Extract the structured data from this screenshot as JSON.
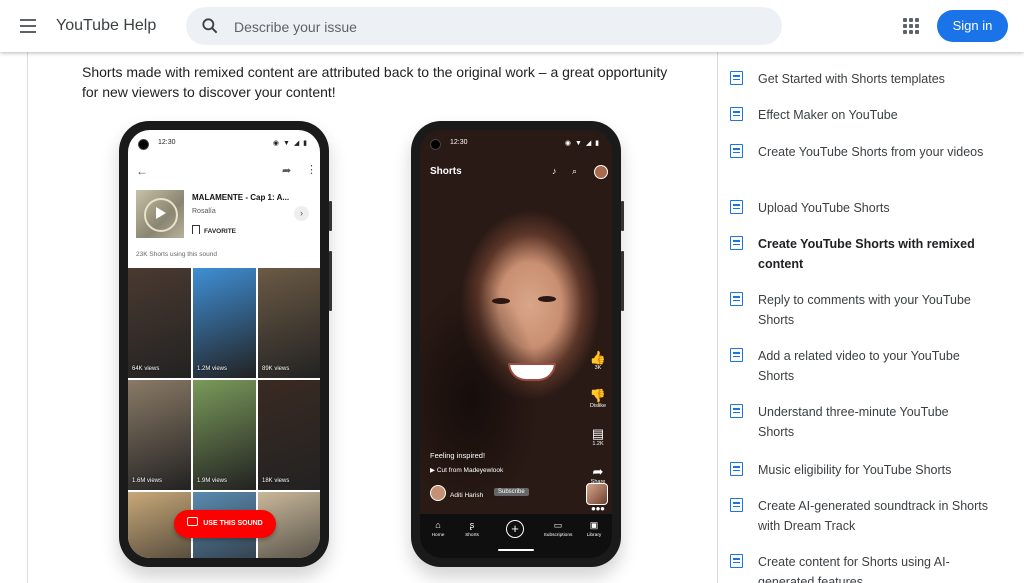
{
  "header": {
    "logo": "YouTube Help",
    "search_placeholder": "Describe your issue",
    "signin_label": "Sign in"
  },
  "main": {
    "intro": "Shorts made with remixed content are attributed back to the original work – a great opportunity for new viewers to discover your content!",
    "phone1": {
      "time": "12:30",
      "song_title": "MALAMENTE - Cap 1: A...",
      "artist": "Rosalía",
      "favorite_label": "FAVORITE",
      "shorts_count": "23K Shorts using this sound",
      "tiles": [
        {
          "views": "64K views",
          "color": "#4a3a30"
        },
        {
          "views": "1.2M views",
          "color": "#3f8fd6"
        },
        {
          "views": "89K views",
          "color": "#6b5a45"
        },
        {
          "views": "1.6M views",
          "color": "#8a7a66"
        },
        {
          "views": "1.9M views",
          "color": "#7a9a5a"
        },
        {
          "views": "18K views",
          "color": "#3a2a22"
        },
        {
          "views": "",
          "color": "#c8a878"
        },
        {
          "views": "",
          "color": "#5a8ab0"
        },
        {
          "views": "",
          "color": "#c9b89a"
        }
      ],
      "use_sound_label": "USE THIS SOUND"
    },
    "phone2": {
      "time": "12:30",
      "title": "Shorts",
      "like_count": "3K",
      "dislike_label": "Dislike",
      "comment_count": "1.2K",
      "share_label": "Share",
      "caption": "Feeling inspired!",
      "cut_from": "Cut from Madeyewlook",
      "username": "Aditi Harish",
      "subscribe_label": "Subscribe",
      "nav": {
        "home": "Home",
        "shorts": "Shorts",
        "subscriptions": "Subscriptions",
        "library": "Library"
      }
    }
  },
  "sidebar": {
    "items": [
      {
        "label": "Get Started with Shorts templates"
      },
      {
        "label": "Effect Maker on YouTube"
      },
      {
        "label": "Create YouTube Shorts from your videos"
      },
      {
        "label": "Upload YouTube Shorts"
      },
      {
        "label": "Create YouTube Shorts with remixed content",
        "active": true
      },
      {
        "label": "Reply to comments with your YouTube Shorts"
      },
      {
        "label": "Add a related video to your YouTube Shorts"
      },
      {
        "label": "Understand three-minute YouTube Shorts"
      },
      {
        "label": "Music eligibility for YouTube Shorts"
      },
      {
        "label": "Create AI-generated soundtrack in Shorts with Dream Track"
      },
      {
        "label": "Create content for Shorts using AI-generated features"
      }
    ]
  }
}
